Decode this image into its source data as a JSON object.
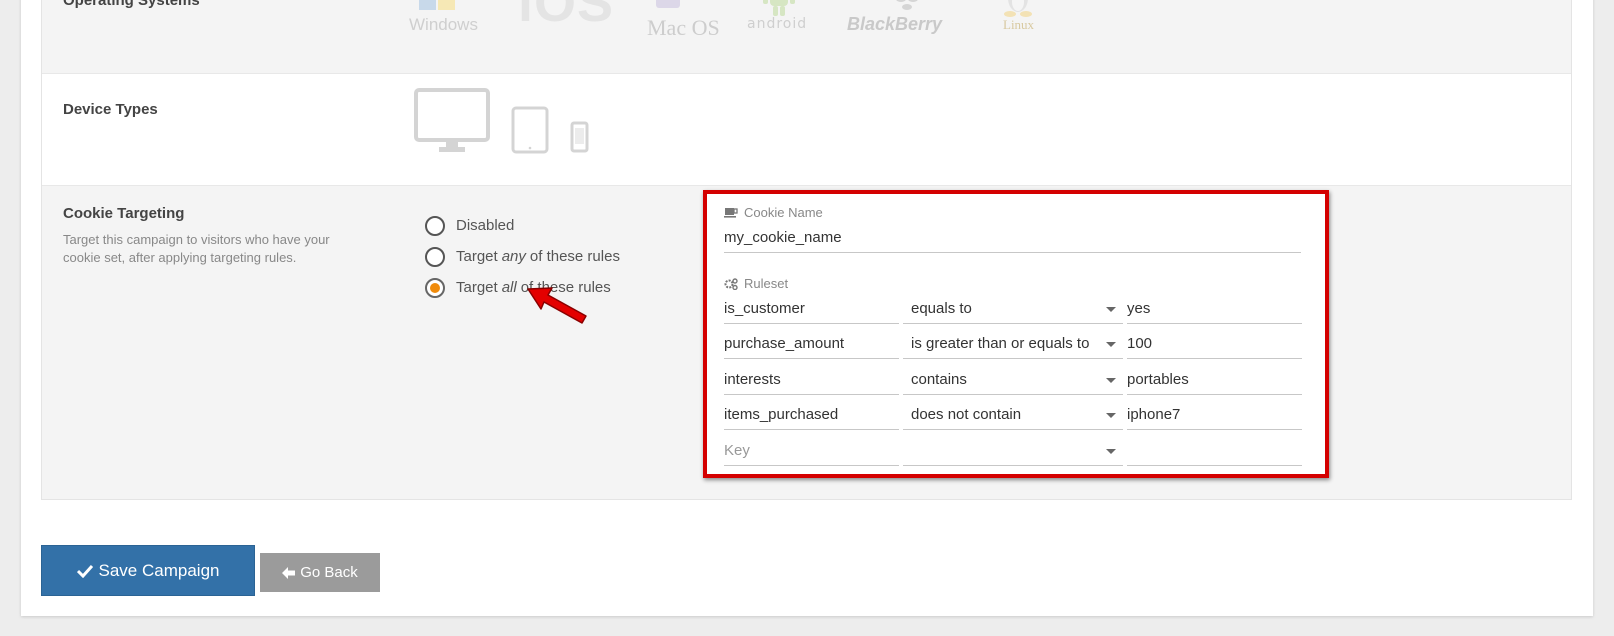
{
  "rows": {
    "os": {
      "title": "Operating Systems",
      "logos": [
        "Windows",
        "iOS",
        "Mac OS",
        "android",
        "BlackBerry",
        "Linux"
      ]
    },
    "devices": {
      "title": "Device Types",
      "icons": [
        "desktop-icon",
        "tablet-icon",
        "phone-icon"
      ]
    },
    "cookie": {
      "title": "Cookie Targeting",
      "description": "Target this campaign to visitors who have your cookie set, after applying targeting rules.",
      "options": [
        {
          "label": "Disabled",
          "selected": false
        },
        {
          "pre": "Target",
          "em": "any",
          "post": "of these rules",
          "selected": false
        },
        {
          "pre": "Target",
          "em": "all",
          "post": "of these rules",
          "selected": true
        }
      ]
    }
  },
  "panel": {
    "cookie_name_label": "Cookie Name",
    "cookie_name_value": "my_cookie_name",
    "ruleset_label": "Ruleset",
    "rules": [
      {
        "key": "is_customer",
        "op": "equals to",
        "value": "yes"
      },
      {
        "key": "purchase_amount",
        "op": "is greater than or equals to",
        "value": "100"
      },
      {
        "key": "interests",
        "op": "contains",
        "value": "portables"
      },
      {
        "key": "items_purchased",
        "op": "does not contain",
        "value": "iphone7"
      }
    ],
    "new_rule": {
      "key_placeholder": "Key",
      "op": "",
      "value": ""
    },
    "highlight_color": "#d40000"
  },
  "buttons": {
    "save": "Save Campaign",
    "back": "Go Back"
  },
  "colors": {
    "save": "#3371a8",
    "back": "#9b9b9b",
    "radio_selected": "#f08b0b"
  }
}
